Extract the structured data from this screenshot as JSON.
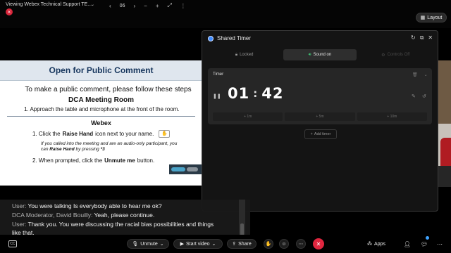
{
  "topbar": {
    "viewing_title": "Viewing Webex Technical Support TE...",
    "page_number": "06",
    "layout_label": "Layout"
  },
  "document": {
    "header": "Open for Public Comment",
    "intro": "To make a public comment, please follow these steps",
    "room_title": "DCA Meeting Room",
    "room_step": "1.  Approach the table and microphone at the front of the room.",
    "webex_title": "Webex",
    "webex_step1_prefix": "1.  Click the",
    "webex_step1_bold": "Raise Hand",
    "webex_step1_suffix": "icon next to your name.",
    "webex_note_a": "If you called into the meeting and are an audio-only participant, you can",
    "webex_note_bold": "Raise Hand",
    "webex_note_b": "by pressing",
    "webex_note_key": "*3",
    "webex_step2_prefix": "2.  When prompted, click the",
    "webex_step2_bold": "Unmute me",
    "webex_step2_suffix": "button."
  },
  "timer_panel": {
    "title": "Shared Timer",
    "tabs": [
      {
        "label": "Locked",
        "icon": "lock-icon",
        "state": "normal"
      },
      {
        "label": "Sound on",
        "icon": "speaker-icon",
        "state": "active"
      },
      {
        "label": "Controls Off",
        "icon": "controls-icon",
        "state": "disabled"
      }
    ],
    "timer": {
      "label": "Timer",
      "minutes": "01",
      "seconds": "42",
      "presets": [
        "+ 1m",
        "+ 5m",
        "+ 10m"
      ]
    },
    "add_timer_label": "Add timer"
  },
  "captions": [
    {
      "speaker": "User:",
      "text": "You were talking Is everybody able to hear me ok?"
    },
    {
      "speaker": "DCA Moderator, David Bouilly:",
      "text": "Yeah, please continue."
    },
    {
      "speaker": "User:",
      "text": "Thank you. You were discussing the racial bias possibilities and things"
    },
    {
      "speaker": "",
      "text": "like that."
    }
  ],
  "controls": {
    "unmute_label": "Unmute",
    "start_video_label": "Start video",
    "share_label": "Share",
    "apps_label": "Apps"
  },
  "colors": {
    "end_call": "#e0263f",
    "sound_on_icon": "#3fd17a",
    "recording_dot": "#d9263b",
    "timer_logo": "#3f8cff"
  }
}
